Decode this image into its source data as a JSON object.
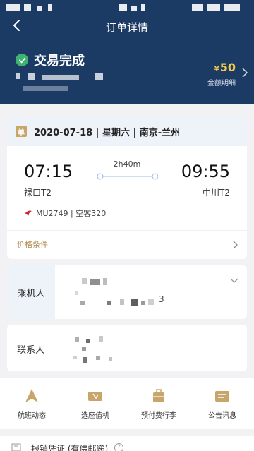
{
  "colors": {
    "header_bg": "#1b3a64",
    "success": "#3cb371",
    "amount_gold": "#f1c94b",
    "accent_gold": "#c8a66a",
    "route_blue": "#9bbbe6"
  },
  "nav": {
    "title": "订单详情",
    "back_icon": "chevron-left-icon"
  },
  "order": {
    "status": "交易完成",
    "status_icon": "check-circle-icon",
    "amount_currency": "¥",
    "amount_value": "50",
    "amount_label": "金额明细"
  },
  "flight": {
    "ticket_badge": "单",
    "date_line": "2020-07-18 | 星期六 | 南京-兰州",
    "dep_time": "07:15",
    "arr_time": "09:55",
    "duration": "2h40m",
    "dep_airport": "禄口T2",
    "arr_airport": "中川T2",
    "flight_info": "MU2749 | 空客320",
    "airline_icon": "china-eastern-logo-icon",
    "price_conditions": "价格条件"
  },
  "passenger": {
    "label": "乘机人",
    "visible_digit": "3"
  },
  "contact": {
    "label": "联系人"
  },
  "actions": [
    {
      "label": "航班动态",
      "icon": "flight-status-icon"
    },
    {
      "label": "选座值机",
      "icon": "seat-checkin-icon"
    },
    {
      "label": "预付费行李",
      "icon": "luggage-icon"
    },
    {
      "label": "公告讯息",
      "icon": "notice-icon"
    }
  ],
  "bottom": {
    "label": "报销凭证 (有偿邮递)",
    "help": "?"
  }
}
